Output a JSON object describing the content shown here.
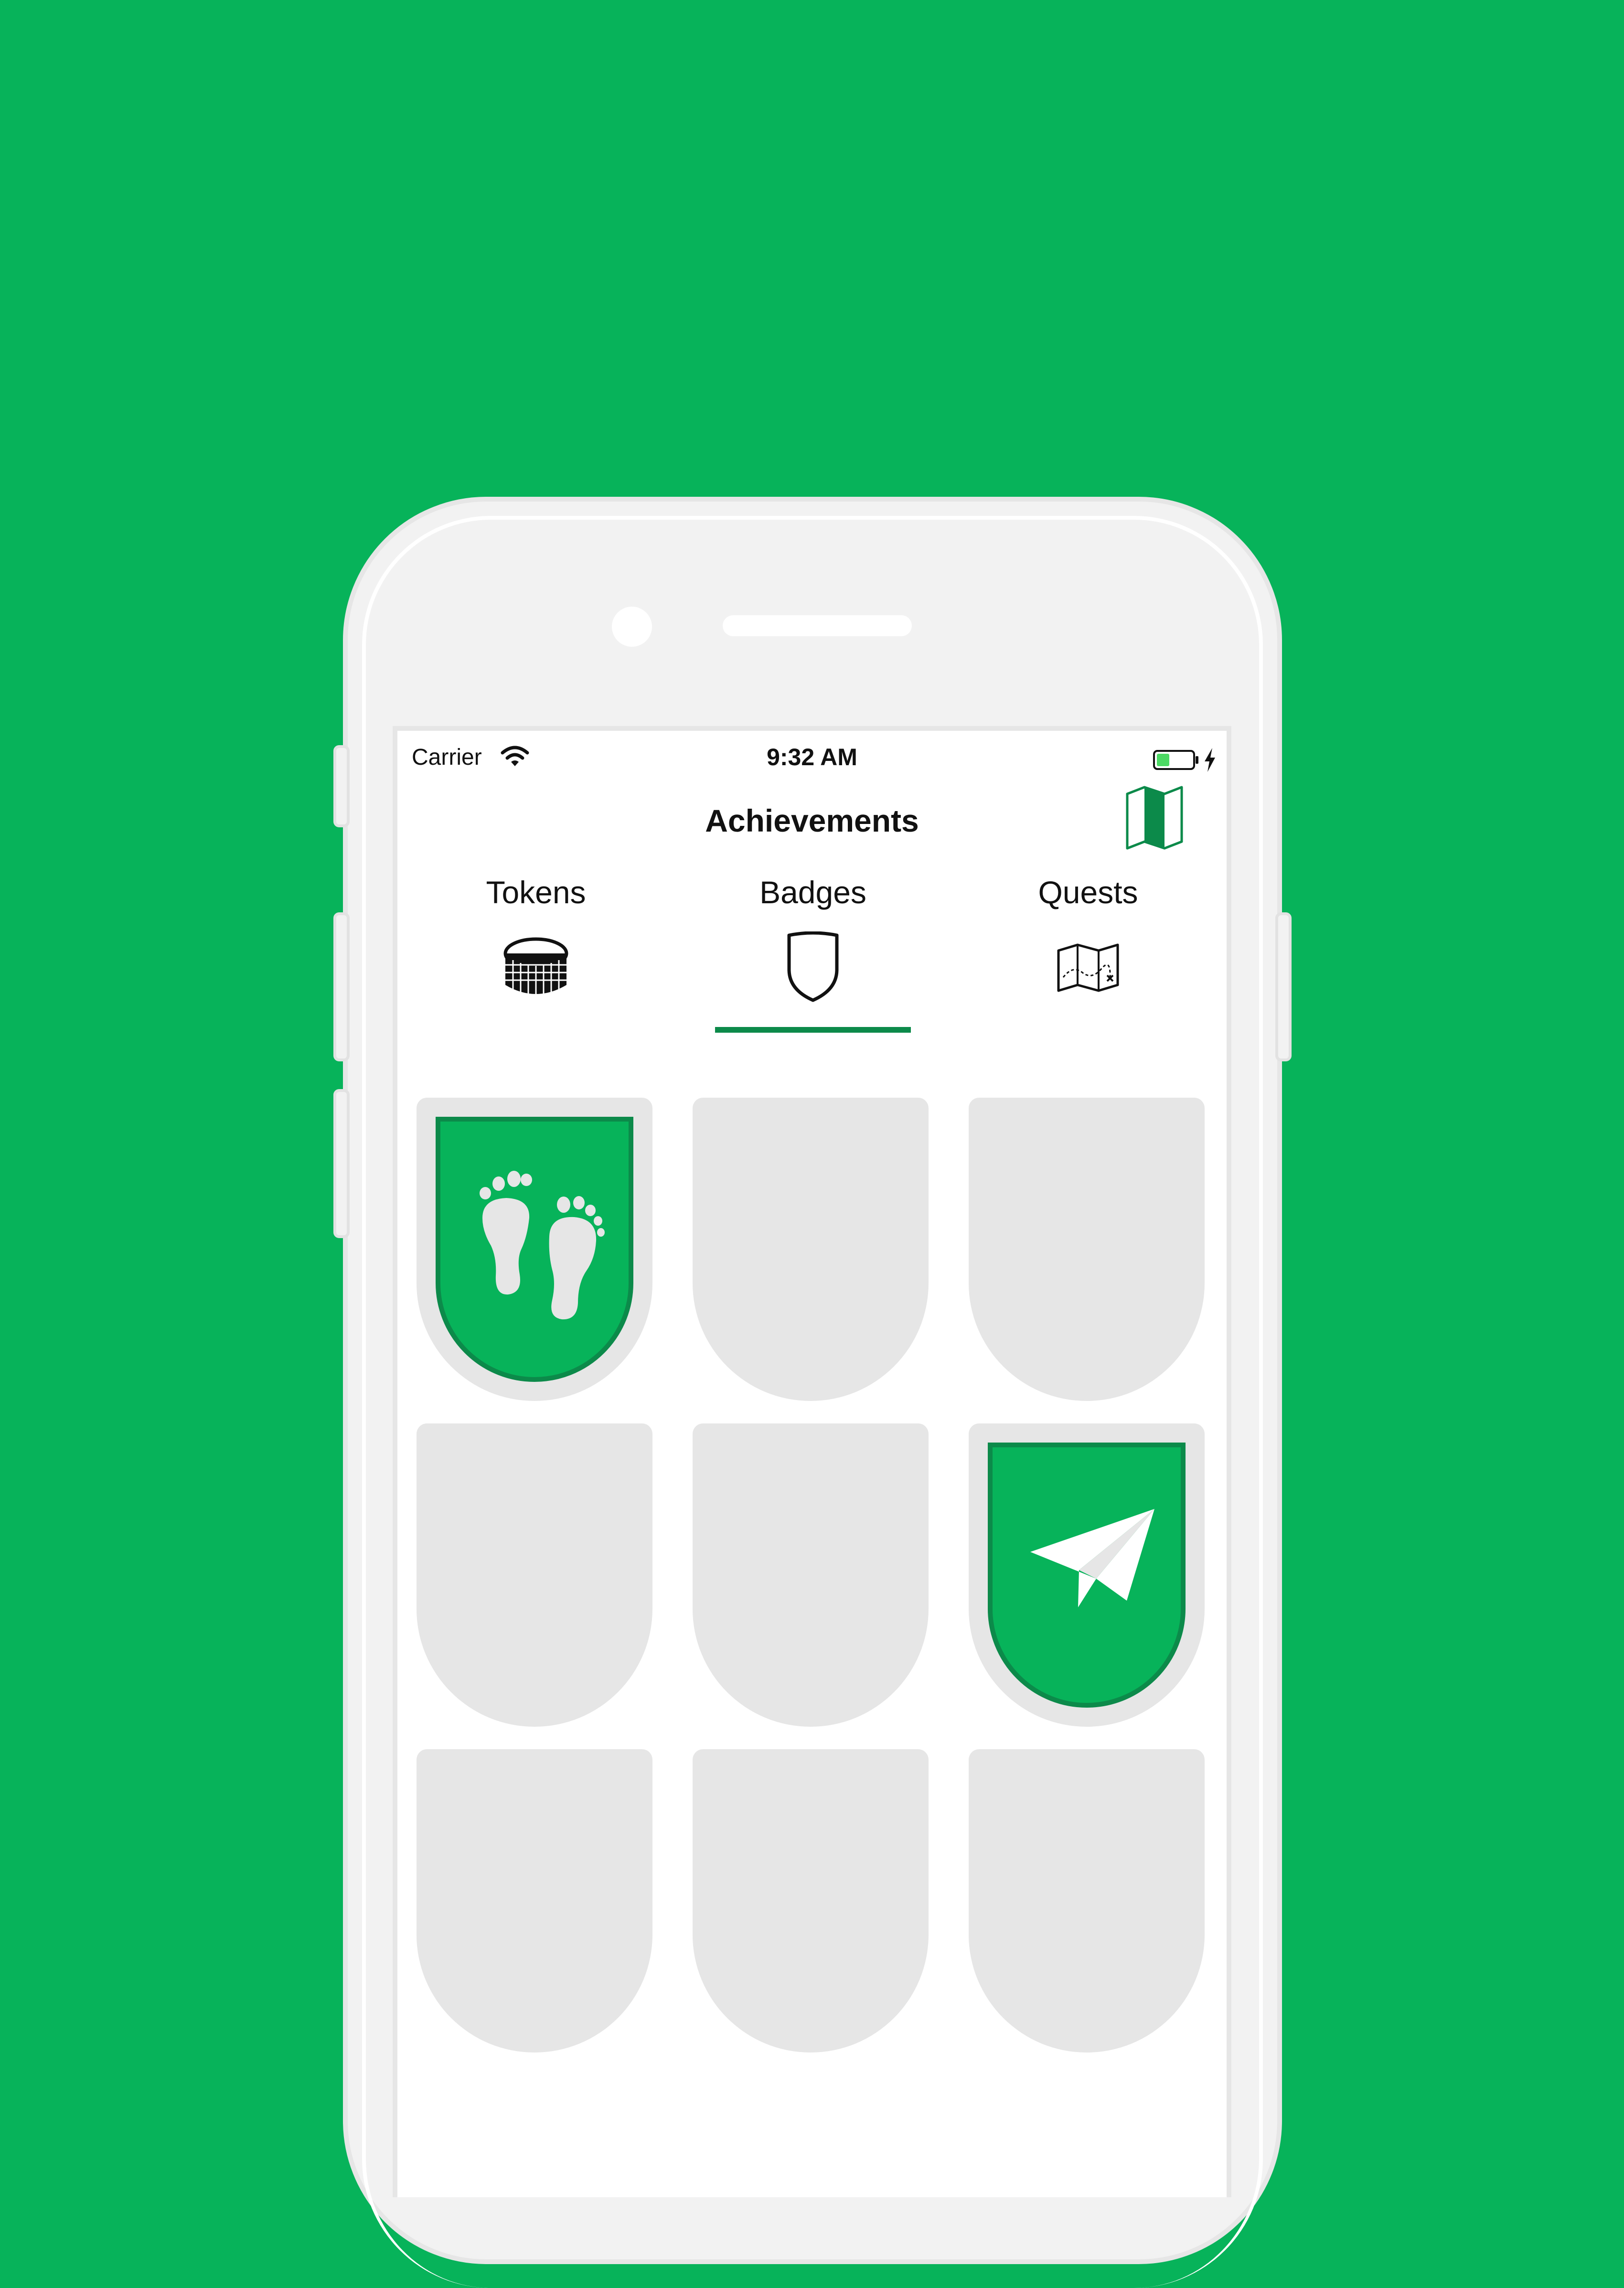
{
  "status_bar": {
    "carrier": "Carrier",
    "time": "9:32 AM"
  },
  "nav": {
    "title": "Achievements",
    "right_icon": "map-icon"
  },
  "tabs": [
    {
      "label": "Tokens",
      "icon": "coins-icon",
      "selected": false
    },
    {
      "label": "Badges",
      "icon": "shield-icon",
      "selected": true
    },
    {
      "label": "Quests",
      "icon": "treasure-map-icon",
      "selected": false
    }
  ],
  "badges": [
    {
      "earned": true,
      "icon": "footprints-icon"
    },
    {
      "earned": false
    },
    {
      "earned": false
    },
    {
      "earned": false
    },
    {
      "earned": false
    },
    {
      "earned": true,
      "icon": "paper-plane-icon"
    },
    {
      "earned": false
    },
    {
      "earned": false
    },
    {
      "earned": false
    }
  ],
  "colors": {
    "background": "#07b35a",
    "accent": "#0c8a4a",
    "slot": "#e6e6e6"
  }
}
